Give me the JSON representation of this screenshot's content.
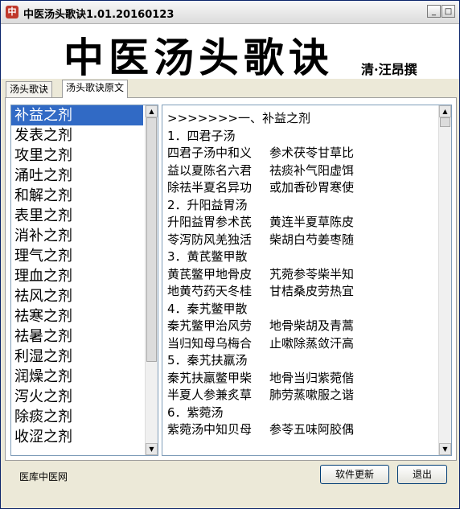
{
  "window": {
    "title": "中医汤头歌诀1.01.20160123",
    "icon_label": "中",
    "controls": [
      "_",
      "□",
      "×"
    ]
  },
  "banner": {
    "title": "中医汤头歌诀",
    "author": "清·汪昂撰"
  },
  "tabs": [
    {
      "label": "汤头歌诀",
      "active": false
    },
    {
      "label": "汤头歌诀原文",
      "active": true
    }
  ],
  "list": {
    "selected_index": 0,
    "items": [
      "补益之剂",
      "发表之剂",
      "攻里之剂",
      "涌吐之剂",
      "和解之剂",
      "表里之剂",
      "消补之剂",
      "理气之剂",
      "理血之剂",
      "祛风之剂",
      "祛寒之剂",
      "祛暑之剂",
      "利湿之剂",
      "润燥之剂",
      "泻火之剂",
      "除痰之剂",
      "收涩之剂"
    ]
  },
  "content": {
    "lines": [
      {
        "a": ">>>>>>>一、补益之剂",
        "b": ""
      },
      {
        "a": "1．四君子汤",
        "b": ""
      },
      {
        "a": "四君子汤中和义",
        "b": "参术茯苓甘草比"
      },
      {
        "a": "益以夏陈名六君",
        "b": "祛痰补气阳虚饵"
      },
      {
        "a": "除祛半夏名异功",
        "b": "或加香砂胃寒使"
      },
      {
        "a": "2．升阳益胃汤",
        "b": ""
      },
      {
        "a": "升阳益胃参术芪",
        "b": "黄连半夏草陈皮"
      },
      {
        "a": "苓泻防风羌独活",
        "b": "柴胡白芍姜枣随"
      },
      {
        "a": "3．黄芪鳖甲散",
        "b": ""
      },
      {
        "a": "黄芪鳖甲地骨皮",
        "b": "艽菀参苓柴半知"
      },
      {
        "a": "地黄芍药天冬桂",
        "b": "甘桔桑皮劳热宜"
      },
      {
        "a": "4．秦艽鳖甲散",
        "b": ""
      },
      {
        "a": "秦艽鳖甲治风劳",
        "b": "地骨柴胡及青蒿"
      },
      {
        "a": "当归知母乌梅合",
        "b": "止嗽除蒸敛汗高"
      },
      {
        "a": "5．秦艽扶羸汤",
        "b": ""
      },
      {
        "a": "秦艽扶羸鳖甲柴",
        "b": "地骨当归紫菀偕"
      },
      {
        "a": "半夏人参兼炙草",
        "b": "肺劳蒸嗽服之谐"
      },
      {
        "a": "6．紫菀汤",
        "b": ""
      },
      {
        "a": "紫菀汤中知贝母",
        "b": "参苓五味阿胶偶"
      }
    ]
  },
  "status": {
    "left_text": "医库中医网",
    "update_button": "软件更新",
    "exit_button": "退出"
  },
  "scroll": {
    "list_thumb_fraction": 0.75,
    "content_thumb_fraction": 0.02
  },
  "colors": {
    "selection": "#316ac5",
    "window_bg": "#ece9d8"
  }
}
